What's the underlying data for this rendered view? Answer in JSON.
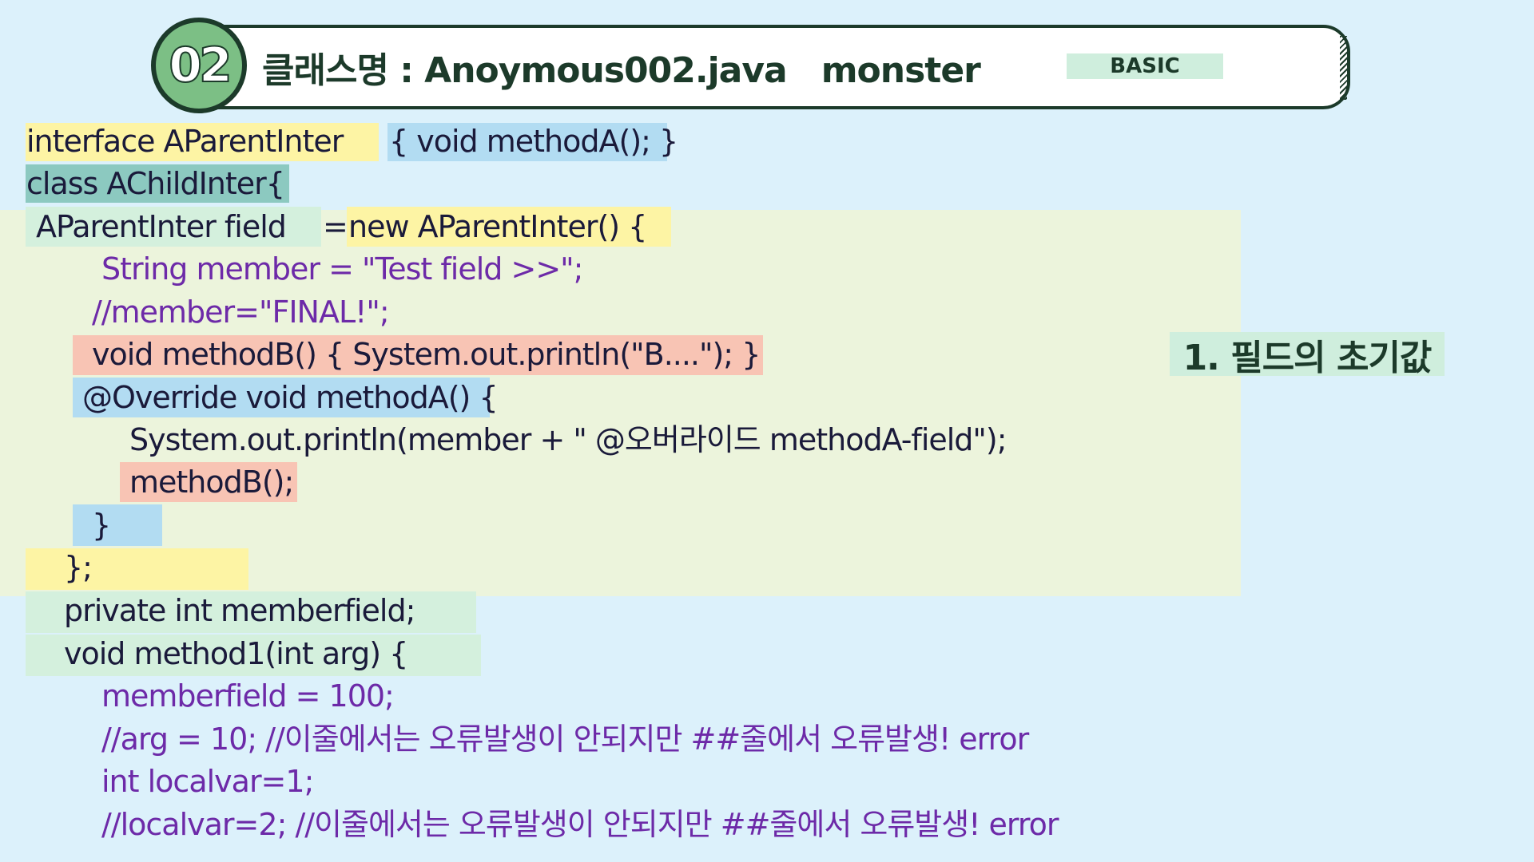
{
  "header": {
    "number": "02",
    "title": "클래스명 : Anoymous002.java   monster",
    "level": "BASIC"
  },
  "side_note": "1. 필드의 초기값",
  "code_lines": [
    "interface AParentInter",
    "{ void methodA(); }",
    "class AChildInter{",
    "AParentInter field",
    "=",
    "new AParentInter() {",
    "String member = \"Test field >>\";",
    "//member=\"FINAL!\";",
    "void methodB() { System.out.println(\"B....\"); }",
    "@Override void methodA() {",
    "System.out.println(member + \" @오버라이드 methodA-field\");",
    "methodB();",
    "}",
    "};",
    "private int memberfield;",
    "void method1(int arg) {",
    "memberfield = 100;",
    "//arg = 10; //이줄에서는 오류발생이 안되지만 ##줄에서 오류발생! error",
    "int localvar=1;",
    "//localvar=2; //이줄에서는 오류발생이 안되지만 ##줄에서 오류발생! error"
  ],
  "colors": {
    "background": "#dcf1fb",
    "yellow_highlight": "#fdf4a4",
    "blue_highlight": "#b2dcf2",
    "teal_highlight": "#8cc9c0",
    "green_highlight": "#d4f0dd",
    "red_highlight": "#f8c4b4",
    "code_dark": "#1a1a3a",
    "code_purple": "#6d2aa8"
  }
}
